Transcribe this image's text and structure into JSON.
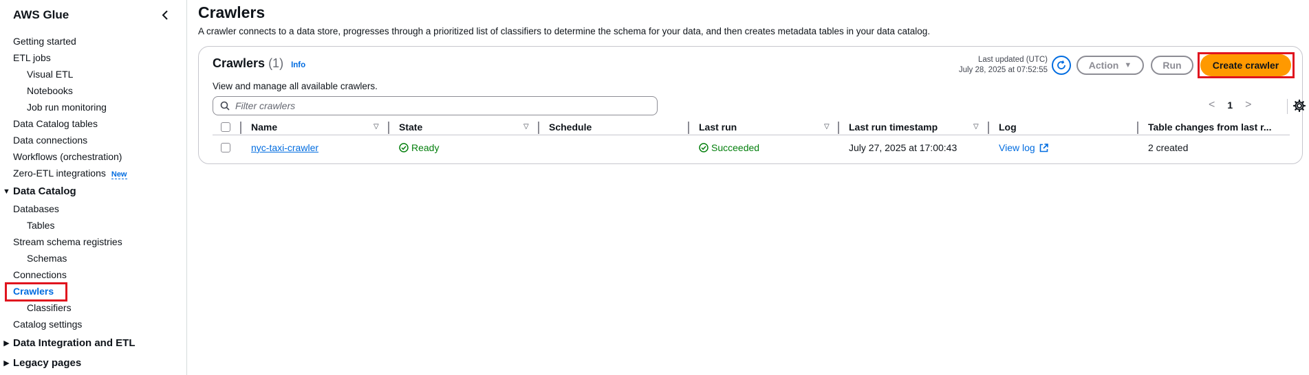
{
  "sidebar": {
    "title": "AWS Glue",
    "items": {
      "getting_started": "Getting started",
      "etl_jobs": "ETL jobs",
      "visual_etl": "Visual ETL",
      "notebooks": "Notebooks",
      "job_run_monitoring": "Job run monitoring",
      "data_catalog_tables": "Data Catalog tables",
      "data_connections": "Data connections",
      "workflows": "Workflows (orchestration)",
      "zero_etl": "Zero-ETL integrations",
      "zero_etl_badge": "New"
    },
    "data_catalog": {
      "label": "Data Catalog",
      "databases": "Databases",
      "tables": "Tables",
      "stream_schema_registries": "Stream schema registries",
      "schemas": "Schemas",
      "connections": "Connections",
      "crawlers": "Crawlers",
      "classifiers": "Classifiers",
      "catalog_settings": "Catalog settings"
    },
    "sections": {
      "data_integration": "Data Integration and ETL",
      "legacy_pages": "Legacy pages"
    }
  },
  "page": {
    "title": "Crawlers",
    "description": "A crawler connects to a data store, progresses through a prioritized list of classifiers to determine the schema for your data, and then creates metadata tables in your data catalog."
  },
  "container": {
    "title": "Crawlers",
    "count": "(1)",
    "info": "Info",
    "subtitle": "View and manage all available crawlers.",
    "last_updated_label": "Last updated (UTC)",
    "last_updated_value": "July 28, 2025 at 07:52:55",
    "action_label": "Action",
    "run_label": "Run",
    "create_label": "Create crawler",
    "filter_placeholder": "Filter crawlers",
    "page_number": "1"
  },
  "table": {
    "headers": {
      "name": "Name",
      "state": "State",
      "schedule": "Schedule",
      "last_run": "Last run",
      "last_run_timestamp": "Last run timestamp",
      "log": "Log",
      "table_changes": "Table changes from last r..."
    },
    "rows": [
      {
        "name": "nyc-taxi-crawler",
        "state": "Ready",
        "schedule": "",
        "last_run": "Succeeded",
        "last_run_timestamp": "July 27, 2025 at 17:00:43",
        "log": "View log",
        "table_changes": "2 created"
      }
    ]
  },
  "colors": {
    "link": "#006ce0",
    "success": "#037f0c",
    "primary_button": "#ff9900",
    "highlight": "#e0141e"
  }
}
